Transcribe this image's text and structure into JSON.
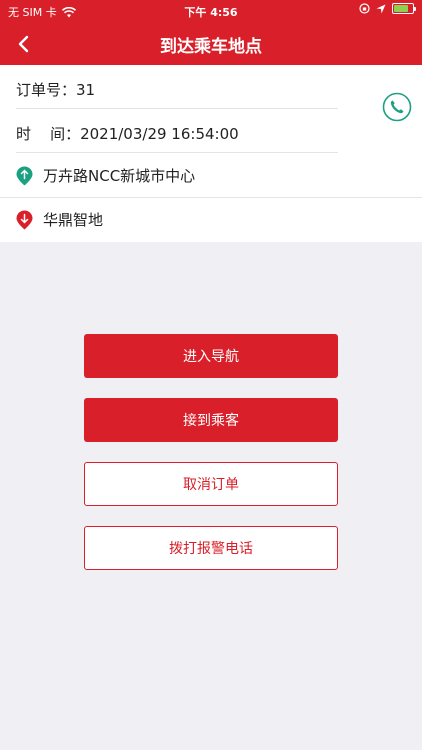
{
  "status_bar": {
    "carrier": "无 SIM 卡",
    "time": "下午 4:56",
    "battery_level": 0.75
  },
  "header": {
    "title": "到达乘车地点",
    "back_icon": "chevron-left-icon"
  },
  "order": {
    "order_no_label": "订单号：",
    "order_no": "31",
    "time_label": "时    间：",
    "time_value": "2021/03/29 16:54:00",
    "start_location": "万卉路NCC新城市中心",
    "end_location": "华鼎智地"
  },
  "colors": {
    "brand": "#d9202a",
    "start_pin": "#1aa181",
    "end_pin": "#d9202a",
    "phone": "#1aa181"
  },
  "actions": {
    "navigate": "进入导航",
    "pickup": "接到乘客",
    "cancel": "取消订单",
    "police": "拨打报警电话"
  }
}
